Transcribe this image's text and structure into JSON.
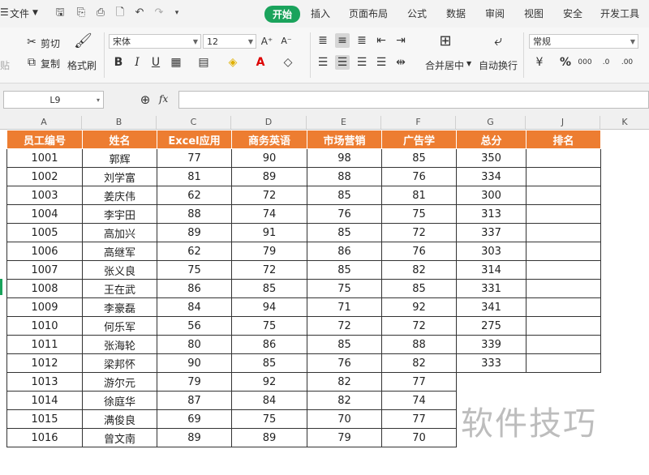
{
  "menubar": {
    "file": "文件",
    "tabs": [
      "开始",
      "插入",
      "页面布局",
      "公式",
      "数据",
      "审阅",
      "视图",
      "安全",
      "开发工具"
    ],
    "active_tab": "开始"
  },
  "ribbon": {
    "cut": "剪切",
    "copy": "复制",
    "paste": "贴",
    "format_painter": "格式刷",
    "font_name": "宋体",
    "font_size": "12",
    "merge_center": "合并居中",
    "wrap_text": "自动换行",
    "number_format": "常规"
  },
  "formula_bar": {
    "name_box": "L9",
    "fx": "fx",
    "formula": ""
  },
  "columns": [
    "A",
    "B",
    "C",
    "D",
    "E",
    "F",
    "G",
    "",
    "J",
    "K"
  ],
  "table": {
    "headers": [
      "员工编号",
      "姓名",
      "Excel应用",
      "商务英语",
      "市场营销",
      "广告学",
      "总分",
      "排名"
    ],
    "rows": [
      [
        "1001",
        "郭辉",
        "77",
        "90",
        "98",
        "85",
        "350",
        ""
      ],
      [
        "1002",
        "刘学富",
        "81",
        "89",
        "88",
        "76",
        "334",
        ""
      ],
      [
        "1003",
        "姜庆伟",
        "62",
        "72",
        "85",
        "81",
        "300",
        ""
      ],
      [
        "1004",
        "李宇田",
        "88",
        "74",
        "76",
        "75",
        "313",
        ""
      ],
      [
        "1005",
        "高加兴",
        "89",
        "91",
        "85",
        "72",
        "337",
        ""
      ],
      [
        "1006",
        "高继军",
        "62",
        "79",
        "86",
        "76",
        "303",
        ""
      ],
      [
        "1007",
        "张义良",
        "75",
        "72",
        "85",
        "82",
        "314",
        ""
      ],
      [
        "1008",
        "王在武",
        "86",
        "85",
        "75",
        "85",
        "331",
        ""
      ],
      [
        "1009",
        "李豪磊",
        "84",
        "94",
        "71",
        "92",
        "341",
        ""
      ],
      [
        "1010",
        "何乐军",
        "56",
        "75",
        "72",
        "72",
        "275",
        ""
      ],
      [
        "1011",
        "张海轮",
        "80",
        "86",
        "85",
        "88",
        "339",
        ""
      ],
      [
        "1012",
        "梁邦怀",
        "90",
        "85",
        "76",
        "82",
        "333",
        ""
      ],
      [
        "1013",
        "游尔元",
        "79",
        "92",
        "82",
        "77",
        "",
        ""
      ],
      [
        "1014",
        "徐庭华",
        "87",
        "84",
        "82",
        "74",
        "",
        ""
      ],
      [
        "1015",
        "满俊良",
        "69",
        "75",
        "70",
        "77",
        "",
        ""
      ],
      [
        "1016",
        "曾文南",
        "89",
        "89",
        "79",
        "70",
        "",
        ""
      ]
    ]
  },
  "watermark": "软件技巧",
  "colors": {
    "header_fill": "#ed7d31",
    "active_tab": "#1aa35c"
  }
}
